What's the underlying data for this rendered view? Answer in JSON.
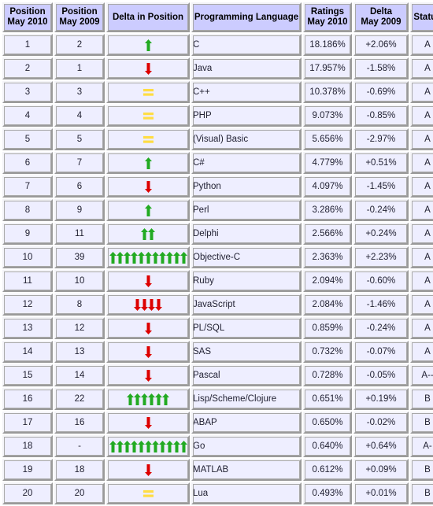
{
  "table": {
    "columns": [
      {
        "id": "position_2010",
        "line1": "Position",
        "line2": "May 2010"
      },
      {
        "id": "position_2009",
        "line1": "Position",
        "line2": "May 2009"
      },
      {
        "id": "delta_position",
        "line1": "Delta in Position",
        "line2": ""
      },
      {
        "id": "language",
        "line1": "Programming Language",
        "line2": ""
      },
      {
        "id": "ratings_2010",
        "line1": "Ratings",
        "line2": "May 2010"
      },
      {
        "id": "delta_2009",
        "line1": "Delta",
        "line2": "May 2009"
      },
      {
        "id": "status",
        "line1": "Status",
        "line2": ""
      }
    ],
    "colors": {
      "header_bg": "#ccccff",
      "cell_bg": "#eeeeff",
      "link_text": "#3333aa",
      "arrow_up": "#22aa22",
      "arrow_down": "#dd0000",
      "equal_bar": "#ffdd44"
    },
    "rows": [
      {
        "position_2010": "1",
        "position_2009": "2",
        "delta_dir": "up",
        "delta_count": 1,
        "language": "C",
        "ratings_2010": "18.186%",
        "delta_2009": "+2.06%",
        "status": "A"
      },
      {
        "position_2010": "2",
        "position_2009": "1",
        "delta_dir": "down",
        "delta_count": 1,
        "language": "Java",
        "ratings_2010": "17.957%",
        "delta_2009": "-1.58%",
        "status": "A"
      },
      {
        "position_2010": "3",
        "position_2009": "3",
        "delta_dir": "equal",
        "delta_count": 1,
        "language": "C++",
        "ratings_2010": "10.378%",
        "delta_2009": "-0.69%",
        "status": "A"
      },
      {
        "position_2010": "4",
        "position_2009": "4",
        "delta_dir": "equal",
        "delta_count": 1,
        "language": "PHP",
        "ratings_2010": "9.073%",
        "delta_2009": "-0.85%",
        "status": "A"
      },
      {
        "position_2010": "5",
        "position_2009": "5",
        "delta_dir": "equal",
        "delta_count": 1,
        "language": "(Visual) Basic",
        "ratings_2010": "5.656%",
        "delta_2009": "-2.97%",
        "status": "A"
      },
      {
        "position_2010": "6",
        "position_2009": "7",
        "delta_dir": "up",
        "delta_count": 1,
        "language": "C#",
        "ratings_2010": "4.779%",
        "delta_2009": "+0.51%",
        "status": "A"
      },
      {
        "position_2010": "7",
        "position_2009": "6",
        "delta_dir": "down",
        "delta_count": 1,
        "language": "Python",
        "ratings_2010": "4.097%",
        "delta_2009": "-1.45%",
        "status": "A"
      },
      {
        "position_2010": "8",
        "position_2009": "9",
        "delta_dir": "up",
        "delta_count": 1,
        "language": "Perl",
        "ratings_2010": "3.286%",
        "delta_2009": "-0.24%",
        "status": "A"
      },
      {
        "position_2010": "9",
        "position_2009": "11",
        "delta_dir": "up",
        "delta_count": 2,
        "language": "Delphi",
        "ratings_2010": "2.566%",
        "delta_2009": "+0.24%",
        "status": "A"
      },
      {
        "position_2010": "10",
        "position_2009": "39",
        "delta_dir": "up",
        "delta_count": 11,
        "language": "Objective-C",
        "ratings_2010": "2.363%",
        "delta_2009": "+2.23%",
        "status": "A"
      },
      {
        "position_2010": "11",
        "position_2009": "10",
        "delta_dir": "down",
        "delta_count": 1,
        "language": "Ruby",
        "ratings_2010": "2.094%",
        "delta_2009": "-0.60%",
        "status": "A"
      },
      {
        "position_2010": "12",
        "position_2009": "8",
        "delta_dir": "down",
        "delta_count": 4,
        "language": "JavaScript",
        "ratings_2010": "2.084%",
        "delta_2009": "-1.46%",
        "status": "A"
      },
      {
        "position_2010": "13",
        "position_2009": "12",
        "delta_dir": "down",
        "delta_count": 1,
        "language": "PL/SQL",
        "ratings_2010": "0.859%",
        "delta_2009": "-0.24%",
        "status": "A"
      },
      {
        "position_2010": "14",
        "position_2009": "13",
        "delta_dir": "down",
        "delta_count": 1,
        "language": "SAS",
        "ratings_2010": "0.732%",
        "delta_2009": "-0.07%",
        "status": "A"
      },
      {
        "position_2010": "15",
        "position_2009": "14",
        "delta_dir": "down",
        "delta_count": 1,
        "language": "Pascal",
        "ratings_2010": "0.728%",
        "delta_2009": "-0.05%",
        "status": "A--"
      },
      {
        "position_2010": "16",
        "position_2009": "22",
        "delta_dir": "up",
        "delta_count": 6,
        "language": "Lisp/Scheme/Clojure",
        "ratings_2010": "0.651%",
        "delta_2009": "+0.19%",
        "status": "B"
      },
      {
        "position_2010": "17",
        "position_2009": "16",
        "delta_dir": "down",
        "delta_count": 1,
        "language": "ABAP",
        "ratings_2010": "0.650%",
        "delta_2009": "-0.02%",
        "status": "B"
      },
      {
        "position_2010": "18",
        "position_2009": "-",
        "delta_dir": "up",
        "delta_count": 11,
        "language": "Go",
        "ratings_2010": "0.640%",
        "delta_2009": "+0.64%",
        "status": "A-"
      },
      {
        "position_2010": "19",
        "position_2009": "18",
        "delta_dir": "down",
        "delta_count": 1,
        "language": "MATLAB",
        "ratings_2010": "0.612%",
        "delta_2009": "+0.09%",
        "status": "B"
      },
      {
        "position_2010": "20",
        "position_2009": "20",
        "delta_dir": "equal",
        "delta_count": 1,
        "language": "Lua",
        "ratings_2010": "0.493%",
        "delta_2009": "+0.01%",
        "status": "B"
      }
    ]
  }
}
